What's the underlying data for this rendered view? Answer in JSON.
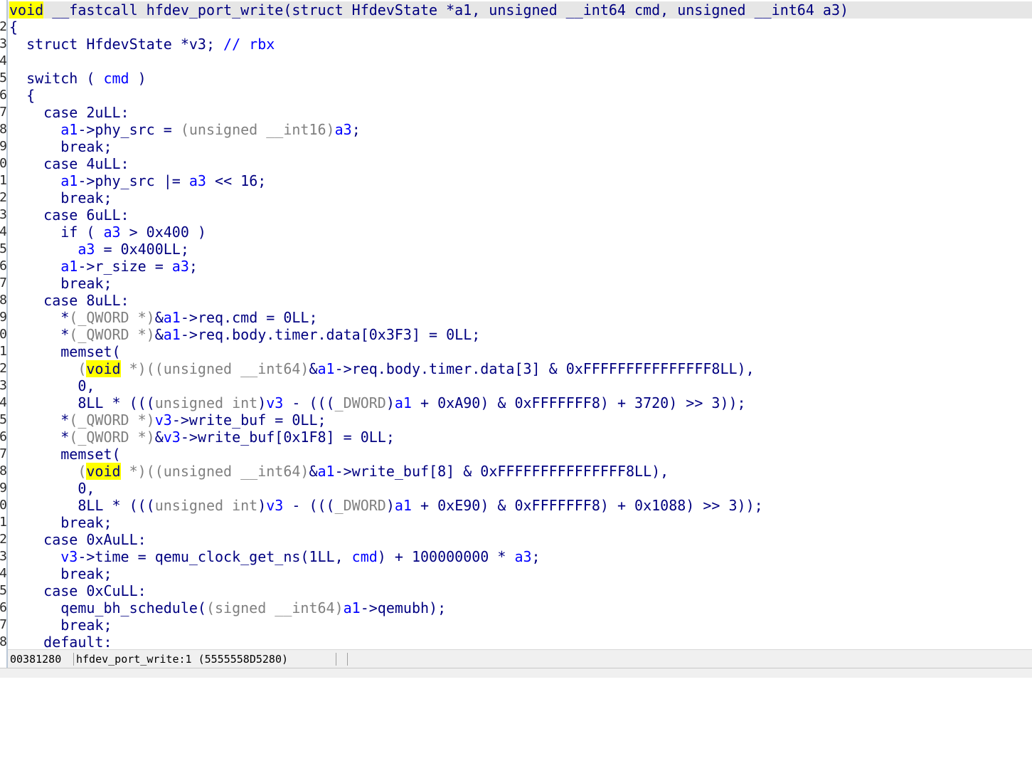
{
  "gutter": [
    "",
    "2",
    "3",
    "4",
    "5",
    "6",
    "7",
    "8",
    "9",
    "0",
    "1",
    "2",
    "3",
    "4",
    "5",
    "6",
    "7",
    "8",
    "9",
    "0",
    "1",
    "2",
    "3",
    "4",
    "5",
    "6",
    "7",
    "8",
    "9",
    "0",
    "1",
    "2",
    "3",
    "4",
    "5",
    "6",
    "7",
    "8"
  ],
  "code_lines": [
    [
      [
        "hl",
        "void"
      ],
      [
        "n",
        " __fastcall hfdev_port_write(struct HfdevState *a1, unsigned __int64 cmd, unsigned __int64 a3)"
      ]
    ],
    [
      [
        "n",
        "{"
      ]
    ],
    [
      [
        "n",
        "  struct HfdevState *v3; "
      ],
      [
        "b",
        "// rbx"
      ]
    ],
    [],
    [
      [
        "n",
        "  switch ( "
      ],
      [
        "b",
        "cmd"
      ],
      [
        "n",
        " )"
      ]
    ],
    [
      [
        "n",
        "  {"
      ]
    ],
    [
      [
        "n",
        "    case 2uLL:"
      ]
    ],
    [
      [
        "n",
        "      "
      ],
      [
        "b",
        "a1"
      ],
      [
        "n",
        "->phy_src = "
      ],
      [
        "g",
        "(unsigned __int16)"
      ],
      [
        "b",
        "a3"
      ],
      [
        "n",
        ";"
      ]
    ],
    [
      [
        "n",
        "      break;"
      ]
    ],
    [
      [
        "n",
        "    case 4uLL:"
      ]
    ],
    [
      [
        "n",
        "      "
      ],
      [
        "b",
        "a1"
      ],
      [
        "n",
        "->phy_src |= "
      ],
      [
        "b",
        "a3"
      ],
      [
        "n",
        " << 16;"
      ]
    ],
    [
      [
        "n",
        "      break;"
      ]
    ],
    [
      [
        "n",
        "    case 6uLL:"
      ]
    ],
    [
      [
        "n",
        "      if ( "
      ],
      [
        "b",
        "a3"
      ],
      [
        "n",
        " > 0x400 )"
      ]
    ],
    [
      [
        "n",
        "        "
      ],
      [
        "b",
        "a3"
      ],
      [
        "n",
        " = 0x400LL;"
      ]
    ],
    [
      [
        "n",
        "      "
      ],
      [
        "b",
        "a1"
      ],
      [
        "n",
        "->r_size = "
      ],
      [
        "b",
        "a3"
      ],
      [
        "n",
        ";"
      ]
    ],
    [
      [
        "n",
        "      break;"
      ]
    ],
    [
      [
        "n",
        "    case 8uLL:"
      ]
    ],
    [
      [
        "n",
        "      *"
      ],
      [
        "g",
        "(_QWORD *)"
      ],
      [
        "n",
        "&"
      ],
      [
        "b",
        "a1"
      ],
      [
        "n",
        "->req.cmd = 0LL;"
      ]
    ],
    [
      [
        "n",
        "      *"
      ],
      [
        "g",
        "(_QWORD *)"
      ],
      [
        "n",
        "&"
      ],
      [
        "b",
        "a1"
      ],
      [
        "n",
        "->req.body.timer.data[0x3F3] = 0LL;"
      ]
    ],
    [
      [
        "n",
        "      memset("
      ]
    ],
    [
      [
        "n",
        "        "
      ],
      [
        "g",
        "("
      ],
      [
        "hl",
        "void"
      ],
      [
        "g",
        " *)((unsigned __int64)"
      ],
      [
        "n",
        "&"
      ],
      [
        "b",
        "a1"
      ],
      [
        "n",
        "->req.body.timer.data[3] & 0xFFFFFFFFFFFFFFF8LL),"
      ]
    ],
    [
      [
        "n",
        "        0,"
      ]
    ],
    [
      [
        "n",
        "        8LL * ((("
      ],
      [
        "g",
        "unsigned int"
      ],
      [
        "n",
        ")"
      ],
      [
        "b",
        "v3"
      ],
      [
        "n",
        " - ((("
      ],
      [
        "g",
        "_DWORD"
      ],
      [
        "n",
        ")"
      ],
      [
        "b",
        "a1"
      ],
      [
        "n",
        " + 0xA90) & 0xFFFFFFF8) + 3720) >> 3));"
      ]
    ],
    [
      [
        "n",
        "      *"
      ],
      [
        "g",
        "(_QWORD *)"
      ],
      [
        "b",
        "v3"
      ],
      [
        "n",
        "->write_buf = 0LL;"
      ]
    ],
    [
      [
        "n",
        "      *"
      ],
      [
        "g",
        "(_QWORD *)"
      ],
      [
        "n",
        "&"
      ],
      [
        "b",
        "v3"
      ],
      [
        "n",
        "->write_buf[0x1F8] = 0LL;"
      ]
    ],
    [
      [
        "n",
        "      memset("
      ]
    ],
    [
      [
        "n",
        "        "
      ],
      [
        "g",
        "("
      ],
      [
        "hl",
        "void"
      ],
      [
        "g",
        " *)((unsigned __int64)"
      ],
      [
        "n",
        "&"
      ],
      [
        "b",
        "a1"
      ],
      [
        "n",
        "->write_buf[8] & 0xFFFFFFFFFFFFFFF8LL),"
      ]
    ],
    [
      [
        "n",
        "        0,"
      ]
    ],
    [
      [
        "n",
        "        8LL * ((("
      ],
      [
        "g",
        "unsigned int"
      ],
      [
        "n",
        ")"
      ],
      [
        "b",
        "v3"
      ],
      [
        "n",
        " - ((("
      ],
      [
        "g",
        "_DWORD"
      ],
      [
        "n",
        ")"
      ],
      [
        "b",
        "a1"
      ],
      [
        "n",
        " + 0xE90) & 0xFFFFFFF8) + 0x1088) >> 3));"
      ]
    ],
    [
      [
        "n",
        "      break;"
      ]
    ],
    [
      [
        "n",
        "    case 0xAuLL:"
      ]
    ],
    [
      [
        "n",
        "      "
      ],
      [
        "b",
        "v3"
      ],
      [
        "n",
        "->time = qemu_clock_get_ns(1LL, "
      ],
      [
        "b",
        "cmd"
      ],
      [
        "n",
        ") + 100000000 * "
      ],
      [
        "b",
        "a3"
      ],
      [
        "n",
        ";"
      ]
    ],
    [
      [
        "n",
        "      break;"
      ]
    ],
    [
      [
        "n",
        "    case 0xCuLL:"
      ]
    ],
    [
      [
        "n",
        "      qemu_bh_schedule("
      ],
      [
        "g",
        "(signed __int64)"
      ],
      [
        "b",
        "a1"
      ],
      [
        "n",
        "->qemubh);"
      ]
    ],
    [
      [
        "n",
        "      break;"
      ]
    ],
    [
      [
        "n",
        "    default:"
      ]
    ]
  ],
  "status": {
    "address": "00381280",
    "location": "hfdev_port_write:1 (5555558D5280)"
  }
}
